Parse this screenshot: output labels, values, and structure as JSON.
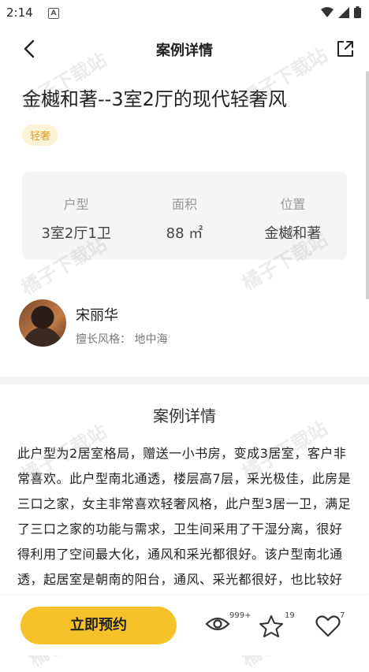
{
  "status_bar": {
    "time": "2:14",
    "notification_letter": "A"
  },
  "header": {
    "title": "案例详情"
  },
  "case": {
    "title": "金樾和著--3室2厅的现代轻奢风",
    "tag": "轻奢"
  },
  "info": [
    {
      "label": "户型",
      "value": "3室2厅1卫"
    },
    {
      "label": "面积",
      "value": "88 ㎡"
    },
    {
      "label": "位置",
      "value": "金樾和著"
    }
  ],
  "designer": {
    "name": "宋丽华",
    "style": "擅长风格： 地中海"
  },
  "detail": {
    "section_title": "案例详情",
    "description": "此户型为2居室格局，赠送一小书房，变成3居室，客户非常喜欢。此户型南北通透，楼层高7层，采光极佳，此房是三口之家，女主非常喜欢轻奢风格，此户型3居一卫，满足了三口之家的功能与需求，卫生间采用了干湿分离，很好得利用了空间最大化，通风和采光都很好。该户型南北通透，起居室是朝南的阳台，通风、采光都很好，也比较好规划，做了很好的设计，空间显得更宽敞"
  },
  "bottom_bar": {
    "book_label": "立即预约",
    "views_count": "999+",
    "favorites_count": "19",
    "likes_count": "7"
  },
  "watermark": "橘子下载站",
  "colors": {
    "accent": "#f6c22a",
    "tag_bg": "#fdf3d6",
    "tag_text": "#e0a12a"
  }
}
